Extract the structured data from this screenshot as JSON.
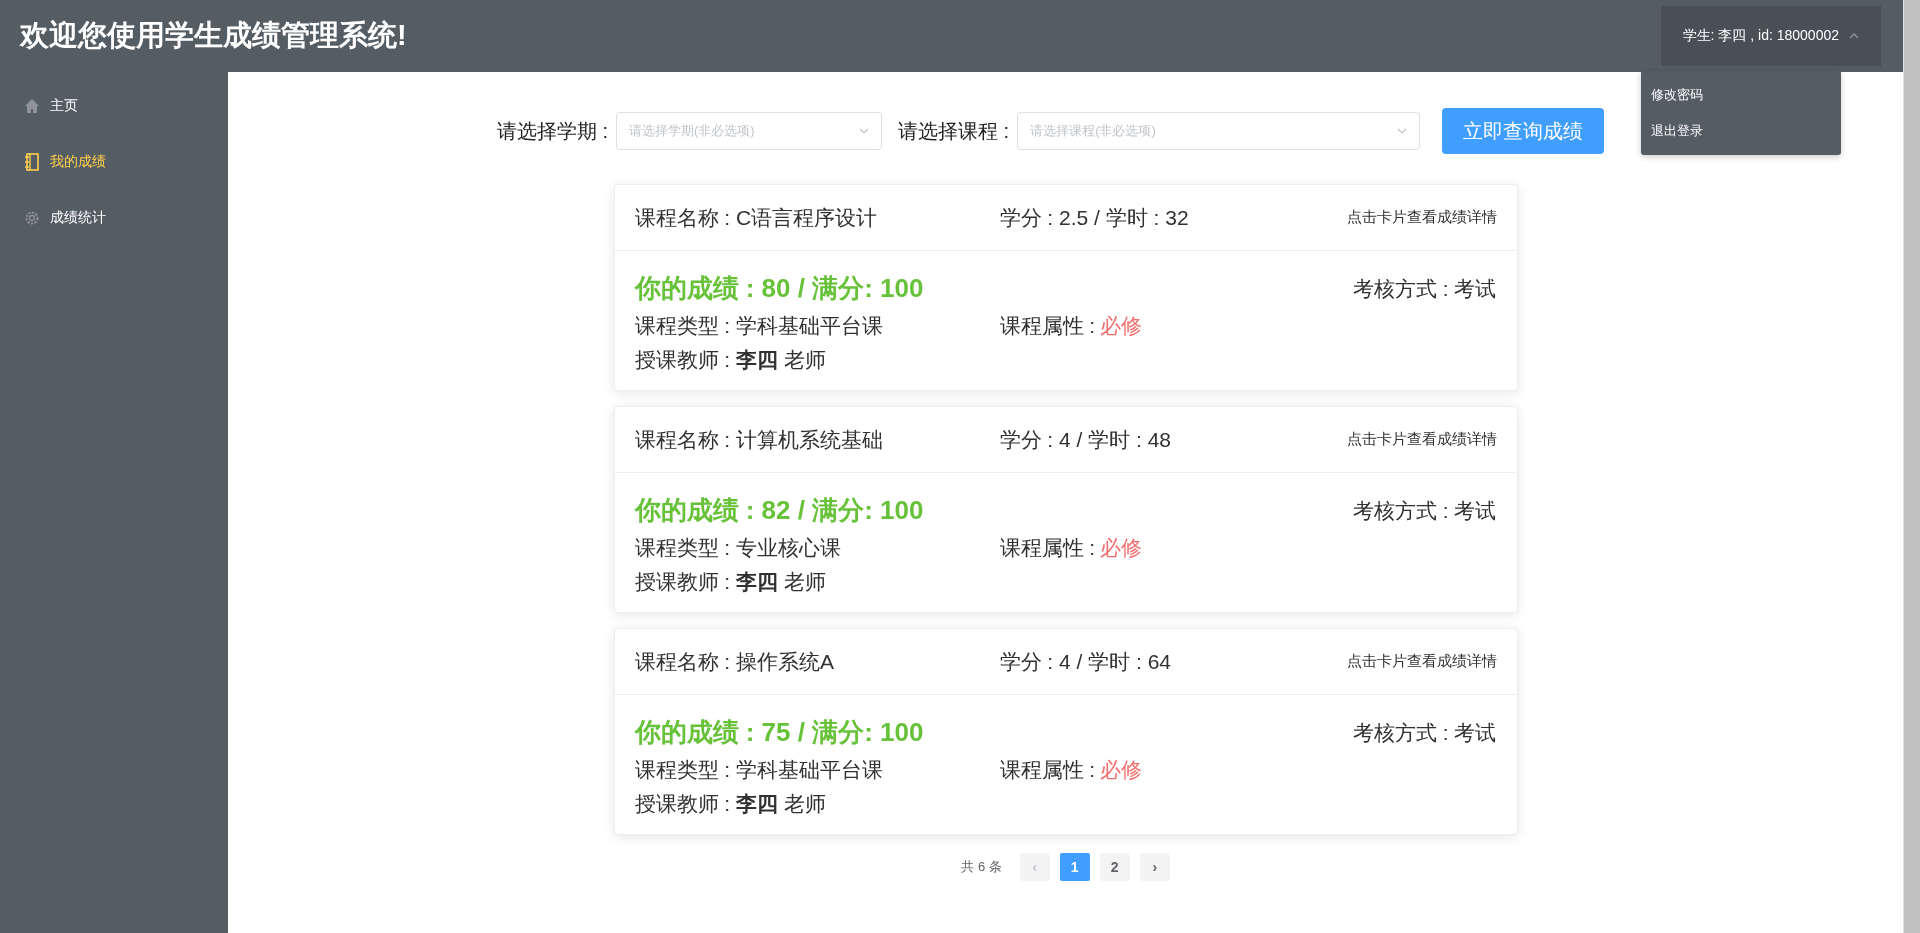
{
  "header": {
    "title": "欢迎您使用学生成绩管理系统!",
    "user": {
      "label": "学生: 李四 , id: 18000002",
      "expanded": true
    },
    "user_menu": [
      "修改密码",
      "退出登录"
    ]
  },
  "sidebar": {
    "items": [
      {
        "label": "主页",
        "selected": false
      },
      {
        "label": "我的成绩",
        "selected": true
      },
      {
        "label": "成绩统计",
        "selected": false
      }
    ]
  },
  "filters": [
    {
      "label": "请选择学期 :",
      "placeholder": "请选择学期(非必选项)"
    },
    {
      "label": "请选择课程 :",
      "placeholder": "请选择课程(非必选项)"
    }
  ],
  "query_button": "立即查询成绩",
  "cards": [
    {
      "name": "课程名称 : C语言程序设计",
      "credit": "学分 : 2.5 / 学时 : 32",
      "hint": "点击卡片查看成绩详情",
      "score": "你的成绩 : 80 / 满分: 100",
      "exam": "考核方式 : 考试",
      "type": "课程类型 : 学科基础平台课",
      "attr_label": "课程属性 :",
      "attr_value": "必修",
      "teacher": "授课教师 : **李四** 老师"
    },
    {
      "name": "课程名称 : 计算机系统基础",
      "credit": "学分 : 4 / 学时 : 48",
      "hint": "点击卡片查看成绩详情",
      "score": "你的成绩 : 82 / 满分: 100",
      "exam": "考核方式 : 考试",
      "type": "课程类型 : 专业核心课",
      "attr_label": "课程属性 :",
      "attr_value": "必修",
      "teacher": "授课教师 : **李四** 老师"
    },
    {
      "name": "课程名称 : 操作系统A",
      "credit": "学分 : 4 / 学时 : 64",
      "hint": "点击卡片查看成绩详情",
      "score": "你的成绩 : 75 / 满分: 100",
      "exam": "考核方式 : 考试",
      "type": "课程类型 : 学科基础平台课",
      "attr_label": "课程属性 :",
      "attr_value": "必修",
      "teacher": "授课教师 : **李四** 老师"
    }
  ],
  "pagination": {
    "total": "共 6 条",
    "prev": "‹",
    "next": "›",
    "pages": [
      {
        "label": "1",
        "selected": true
      },
      {
        "label": "2",
        "selected": false
      }
    ]
  }
}
